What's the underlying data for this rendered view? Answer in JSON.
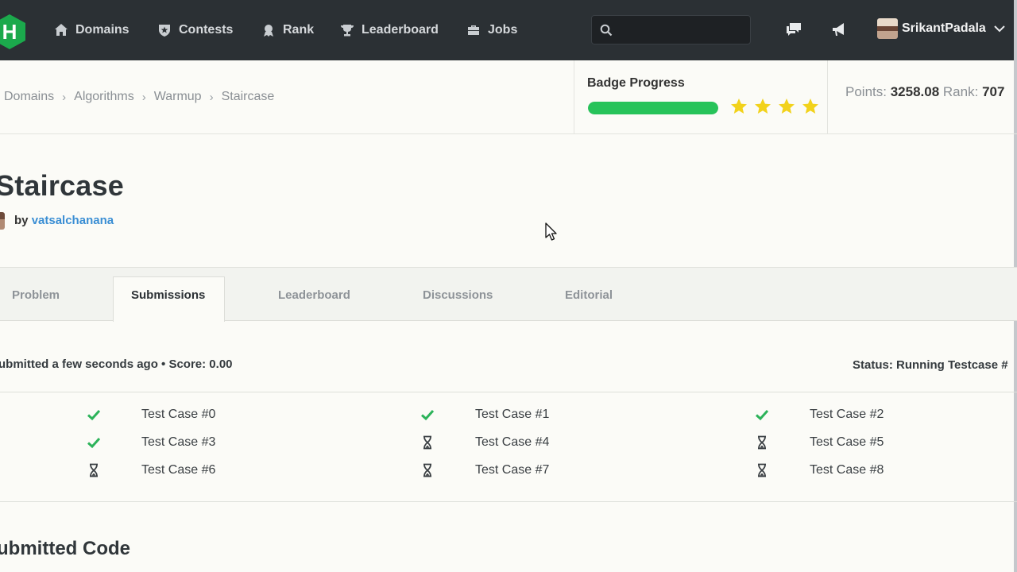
{
  "nav": {
    "logo_letter": "H",
    "items": [
      {
        "label": "Domains",
        "icon": "home-icon"
      },
      {
        "label": "Contests",
        "icon": "shield-star-icon"
      },
      {
        "label": "Rank",
        "icon": "medal-icon"
      },
      {
        "label": "Leaderboard",
        "icon": "trophy-icon"
      },
      {
        "label": "Jobs",
        "icon": "briefcase-icon"
      }
    ],
    "search": {
      "placeholder": "",
      "value": ""
    },
    "username": "SrikantPadala",
    "colors": {
      "bar": "#2b3034",
      "logo": "#1ba94c"
    }
  },
  "breadcrumb": [
    "Domains",
    "Algorithms",
    "Warmup",
    "Staircase"
  ],
  "badge": {
    "title": "Badge Progress",
    "progress_percent": 100,
    "stars": 4,
    "colors": {
      "progress": "#27c35a",
      "star": "#f2d21b"
    }
  },
  "stats": {
    "points_label": "Points:",
    "points_value": "3258.08",
    "rank_label": "Rank:",
    "rank_value": "707"
  },
  "challenge": {
    "title": "Staircase",
    "by_label": "by",
    "author": "vatsalchanana"
  },
  "tabs": [
    {
      "label": "Problem",
      "active": false
    },
    {
      "label": "Submissions",
      "active": true
    },
    {
      "label": "Leaderboard",
      "active": false
    },
    {
      "label": "Discussions",
      "active": false
    },
    {
      "label": "Editorial",
      "active": false
    }
  ],
  "submission": {
    "meta": "ubmitted a few seconds ago • Score: 0.00",
    "status": "Status: Running Testcase #"
  },
  "test_cases": [
    {
      "label": "Test Case #0",
      "state": "passed"
    },
    {
      "label": "Test Case #1",
      "state": "passed"
    },
    {
      "label": "Test Case #2",
      "state": "passed"
    },
    {
      "label": "Test Case #3",
      "state": "passed"
    },
    {
      "label": "Test Case #4",
      "state": "pending"
    },
    {
      "label": "Test Case #5",
      "state": "pending"
    },
    {
      "label": "Test Case #6",
      "state": "pending"
    },
    {
      "label": "Test Case #7",
      "state": "pending"
    },
    {
      "label": "Test Case #8",
      "state": "pending"
    }
  ],
  "code_heading": "ubmitted Code",
  "colors": {
    "passed": "#2cb35a",
    "link": "#3a8ed4"
  }
}
